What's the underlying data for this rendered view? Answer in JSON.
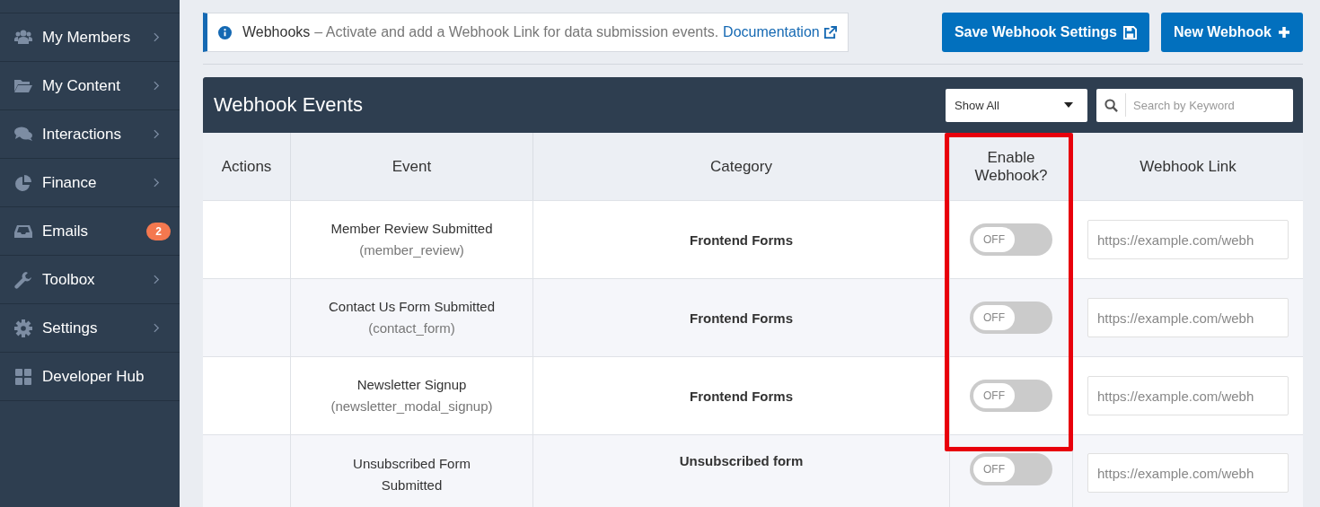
{
  "sidebar": {
    "items": [
      {
        "label": "My Members",
        "kind": "submenu"
      },
      {
        "label": "My Content",
        "kind": "submenu"
      },
      {
        "label": "Interactions",
        "kind": "submenu"
      },
      {
        "label": "Finance",
        "kind": "submenu"
      },
      {
        "label": "Emails",
        "kind": "badge",
        "badge": "2"
      },
      {
        "label": "Toolbox",
        "kind": "submenu"
      },
      {
        "label": "Settings",
        "kind": "submenu"
      },
      {
        "label": "Developer Hub",
        "kind": "link"
      }
    ]
  },
  "notice": {
    "title": "Webhooks",
    "text": "– Activate and add a Webhook Link for data submission events.",
    "link": "Documentation"
  },
  "buttons": [
    {
      "label": "Save Webhook Settings",
      "kind": "save"
    },
    {
      "label": "New Webhook",
      "kind": "add"
    }
  ],
  "panel": {
    "title": "Webhook Events",
    "filter": {
      "value": "Show All"
    },
    "search": {
      "placeholder": "Search by Keyword"
    }
  },
  "table": {
    "columns": [
      "Actions",
      "Event",
      "Category",
      "Enable Webhook?",
      "Webhook Link"
    ],
    "highlight": {
      "kind": "frame",
      "color": "#e8000b"
    },
    "rows": [
      {
        "event": "Member Review Submitted",
        "code": "(member_review)",
        "category": "Frontend Forms",
        "toggle": {
          "on": false,
          "label": "OFF"
        },
        "link": {
          "placeholder": "https://example.com/webh"
        }
      },
      {
        "event": "Contact Us Form Submitted",
        "code": "(contact_form)",
        "category": "Frontend Forms",
        "toggle": {
          "on": false,
          "label": "OFF"
        },
        "link": {
          "placeholder": "https://example.com/webh"
        }
      },
      {
        "event": "Newsletter Signup",
        "code": "(newsletter_modal_signup)",
        "category": "Frontend Forms",
        "toggle": {
          "on": false,
          "label": "OFF"
        },
        "link": {
          "placeholder": "https://example.com/webh"
        }
      },
      {
        "event": "Unsubscribed Form Submitted",
        "category": "Unsubscribed form",
        "toggle": {
          "on": false,
          "label": "OFF"
        },
        "link": {
          "placeholder": "https://example.com/webh"
        }
      }
    ]
  }
}
